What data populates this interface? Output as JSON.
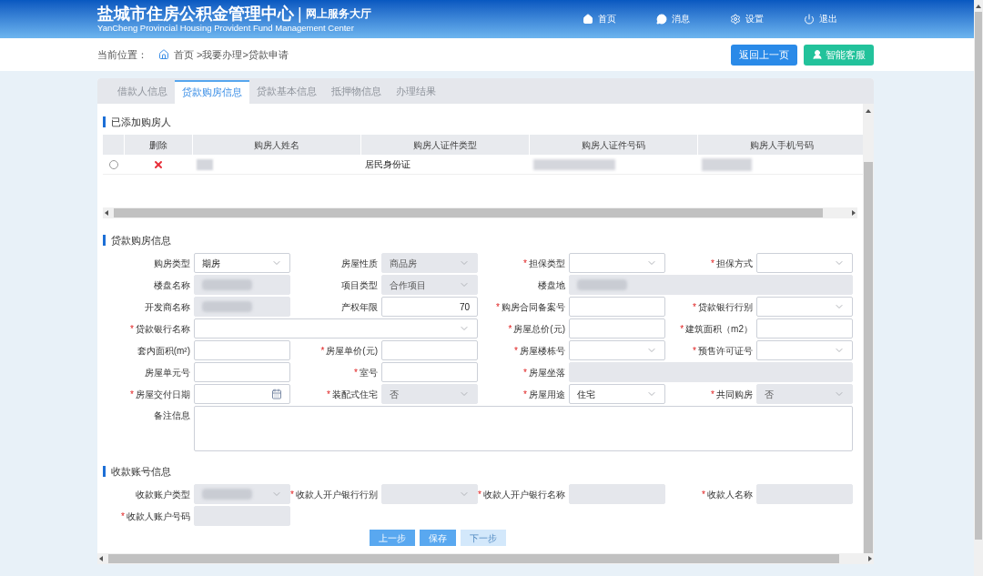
{
  "header": {
    "title": "盐城市住房公积金管理中心",
    "divider": "|",
    "subtitle": "网上服务大厅",
    "english": "YanCheng Provincial Housing Provident Fund Management Center",
    "nav": [
      {
        "kind": "home",
        "label": "首页"
      },
      {
        "kind": "message",
        "label": "消息"
      },
      {
        "kind": "settings",
        "label": "设置"
      },
      {
        "kind": "logout",
        "label": "退出"
      }
    ]
  },
  "breadcrumb": {
    "label": "当前位置：",
    "path": "首页 >我要办理>贷款申请"
  },
  "actions": [
    {
      "kind": "back",
      "label": "返回上一页"
    },
    {
      "kind": "service",
      "label": "智能客服"
    }
  ],
  "tabs": [
    {
      "label": "借款人信息",
      "selected": false
    },
    {
      "label": "贷款购房信息",
      "selected": true
    },
    {
      "label": "贷款基本信息",
      "selected": false
    },
    {
      "label": "抵押物信息",
      "selected": false
    },
    {
      "label": "办理结果",
      "selected": false
    }
  ],
  "buyers": {
    "title": "已添加购房人",
    "columns": [
      "删除",
      "购房人姓名",
      "购房人证件类型",
      "购房人证件号码",
      "购房人手机号码"
    ],
    "rows": [
      {
        "selected": false,
        "name_redacted": true,
        "id_type": "居民身份证",
        "id_redacted": true,
        "phone_redacted": true
      }
    ]
  },
  "loan_section": {
    "title": "贷款购房信息",
    "fields": [
      {
        "label": "购房类型",
        "kind": "select",
        "value": "期房",
        "disabled": false
      },
      {
        "label": "房屋性质",
        "kind": "select",
        "value": "商品房",
        "disabled": true
      },
      {
        "marker": "*",
        "label": "担保类型",
        "kind": "select",
        "disabled": false
      },
      {
        "marker": "*",
        "label": "担保方式",
        "kind": "select",
        "disabled": false
      },
      {
        "label": "楼盘名称",
        "kind": "input",
        "disabled": true,
        "redacted": true
      },
      {
        "label": "项目类型",
        "kind": "select",
        "value": "合作项目",
        "disabled": true
      },
      {
        "label": "楼盘地",
        "kind": "input",
        "disabled": true,
        "redacted": true
      },
      {
        "label": "开发商名称",
        "kind": "input",
        "disabled": true,
        "redacted": true
      },
      {
        "label": "产权年限",
        "kind": "input",
        "value": "70",
        "disabled": false
      },
      {
        "marker": "*",
        "label": "购房合同备案号",
        "kind": "input",
        "disabled": false
      },
      {
        "marker": "*",
        "label": "贷款银行行别",
        "kind": "select",
        "disabled": false
      },
      {
        "marker": "*",
        "label": "贷款银行名称",
        "kind": "select",
        "disabled": false
      },
      {
        "marker": "*",
        "label": "房屋总价(元)",
        "kind": "input",
        "disabled": false
      },
      {
        "marker": "*",
        "label": "建筑面积（m2）",
        "kind": "input",
        "disabled": false
      },
      {
        "label": "套内面积(m²)",
        "kind": "input",
        "disabled": false
      },
      {
        "marker": "*",
        "label": "房屋单价(元)",
        "kind": "input",
        "disabled": false
      },
      {
        "marker": "*",
        "label": "房屋楼栋号",
        "kind": "select",
        "disabled": false
      },
      {
        "marker": "*",
        "label": "预售许可证号",
        "kind": "select",
        "disabled": false
      },
      {
        "label": "房屋单元号",
        "kind": "input",
        "disabled": false
      },
      {
        "marker": "*",
        "label": "室号",
        "kind": "input",
        "disabled": false
      },
      {
        "marker": "*",
        "label": "房屋坐落",
        "kind": "input",
        "disabled": true
      },
      {
        "marker": "*",
        "label": "房屋交付日期",
        "kind": "date",
        "disabled": false
      },
      {
        "marker": "*",
        "label": "装配式住宅",
        "kind": "select",
        "value": "否",
        "disabled": true
      },
      {
        "marker": "*",
        "label": "房屋用途",
        "kind": "select",
        "value": "住宅",
        "disabled": false
      },
      {
        "marker": "*",
        "label": "共同购房",
        "kind": "select",
        "value": "否",
        "disabled": true
      },
      {
        "label": "备注信息",
        "kind": "textarea",
        "disabled": false
      }
    ]
  },
  "account_section": {
    "title": "收款账号信息",
    "fields": [
      {
        "label": "收款账户类型",
        "kind": "select",
        "disabled": true,
        "redacted": true
      },
      {
        "marker": "*",
        "label": "收款人开户银行行别",
        "kind": "select",
        "disabled": true
      },
      {
        "marker": "*",
        "label": "收款人开户银行名称",
        "kind": "input",
        "disabled": true
      },
      {
        "marker": "*",
        "label": "收款人名称",
        "kind": "input",
        "disabled": true
      },
      {
        "marker": "*",
        "label": "收款人账户号码",
        "kind": "input",
        "disabled": true
      }
    ]
  },
  "steps": [
    {
      "label": "上一步",
      "disabled": false
    },
    {
      "label": "保存",
      "disabled": false
    },
    {
      "label": "下一步",
      "disabled": true
    }
  ]
}
